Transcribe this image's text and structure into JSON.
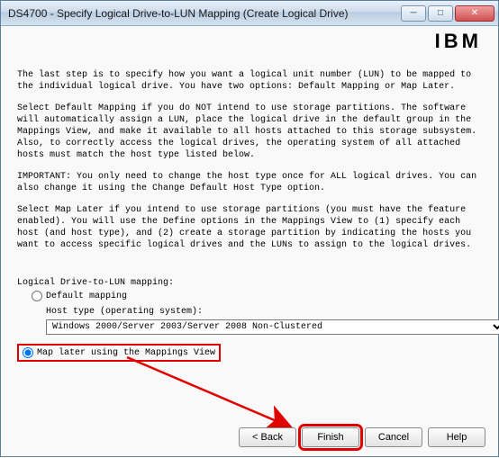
{
  "window": {
    "title": "DS4700 - Specify Logical Drive-to-LUN Mapping (Create Logical Drive)"
  },
  "logo": "IBM",
  "paragraphs": {
    "p1": "The last step is to specify how you want a logical unit number (LUN) to be mapped to the individual logical drive. You have two options: Default Mapping or Map Later.",
    "p2": "Select Default Mapping if you do NOT intend to use storage partitions. The software will automatically assign a LUN, place the logical drive in the default group in the Mappings View, and make it available to all hosts attached to this storage subsystem. Also, to correctly access the logical drives, the operating system of all attached hosts must match the host type listed below.",
    "p3": "IMPORTANT: You only need to change the host type once for ALL logical drives. You can also change it using the Change Default Host Type option.",
    "p4": "Select Map Later if you intend to use storage partitions (you must have the feature enabled). You will use the Define options in the Mappings View to (1) specify each host (and host type), and (2) create a storage partition by indicating the hosts you want to access specific logical drives and the LUNs to assign to the logical drives."
  },
  "mapping": {
    "section_label": "Logical Drive-to-LUN mapping:",
    "default_label": "Default mapping",
    "host_type_label": "Host type (operating system):",
    "host_type_value": "Windows 2000/Server 2003/Server 2008 Non-Clustered",
    "map_later_label": "Map later using the Mappings View"
  },
  "buttons": {
    "back": "< Back",
    "finish": "Finish",
    "cancel": "Cancel",
    "help": "Help"
  }
}
